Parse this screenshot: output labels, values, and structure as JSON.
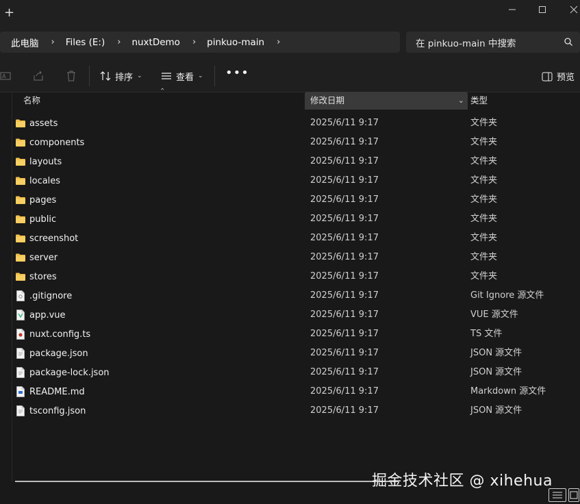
{
  "titlebar": {
    "new_tab": "+"
  },
  "address": {
    "crumbs": [
      "此电脑",
      "Files (E:)",
      "nuxtDemo",
      "pinkuo-main"
    ]
  },
  "search": {
    "placeholder": "在 pinkuo-main 中搜索"
  },
  "toolbar": {
    "sort_label": "排序",
    "view_label": "查看",
    "more_label": "•••",
    "preview_label": "预览"
  },
  "columns": {
    "name": "名称",
    "modified": "修改日期",
    "type": "类型"
  },
  "files": [
    {
      "name": "assets",
      "date": "2025/6/11 9:17",
      "type": "文件夹",
      "icon": "folder-icon"
    },
    {
      "name": "components",
      "date": "2025/6/11 9:17",
      "type": "文件夹",
      "icon": "folder-icon"
    },
    {
      "name": "layouts",
      "date": "2025/6/11 9:17",
      "type": "文件夹",
      "icon": "folder-icon"
    },
    {
      "name": "locales",
      "date": "2025/6/11 9:17",
      "type": "文件夹",
      "icon": "folder-icon"
    },
    {
      "name": "pages",
      "date": "2025/6/11 9:17",
      "type": "文件夹",
      "icon": "folder-icon"
    },
    {
      "name": "public",
      "date": "2025/6/11 9:17",
      "type": "文件夹",
      "icon": "folder-icon"
    },
    {
      "name": "screenshot",
      "date": "2025/6/11 9:17",
      "type": "文件夹",
      "icon": "folder-icon"
    },
    {
      "name": "server",
      "date": "2025/6/11 9:17",
      "type": "文件夹",
      "icon": "folder-icon"
    },
    {
      "name": "stores",
      "date": "2025/6/11 9:17",
      "type": "文件夹",
      "icon": "folder-icon"
    },
    {
      "name": ".gitignore",
      "date": "2025/6/11 9:17",
      "type": "Git Ignore 源文件",
      "icon": "git-file-icon"
    },
    {
      "name": "app.vue",
      "date": "2025/6/11 9:17",
      "type": "VUE 源文件",
      "icon": "vue-file-icon"
    },
    {
      "name": "nuxt.config.ts",
      "date": "2025/6/11 9:17",
      "type": "TS 文件",
      "icon": "ts-file-icon"
    },
    {
      "name": "package.json",
      "date": "2025/6/11 9:17",
      "type": "JSON 源文件",
      "icon": "json-file-icon"
    },
    {
      "name": "package-lock.json",
      "date": "2025/6/11 9:17",
      "type": "JSON 源文件",
      "icon": "json-file-icon"
    },
    {
      "name": "README.md",
      "date": "2025/6/11 9:17",
      "type": "Markdown 源文件",
      "icon": "markdown-file-icon"
    },
    {
      "name": "tsconfig.json",
      "date": "2025/6/11 9:17",
      "type": "JSON 源文件",
      "icon": "json-file-icon"
    }
  ],
  "watermark": "掘金技术社区 @ xihehua",
  "colors": {
    "background": "#191919",
    "folder": "#f2c14e",
    "sorted_header": "#3a3a3a"
  }
}
